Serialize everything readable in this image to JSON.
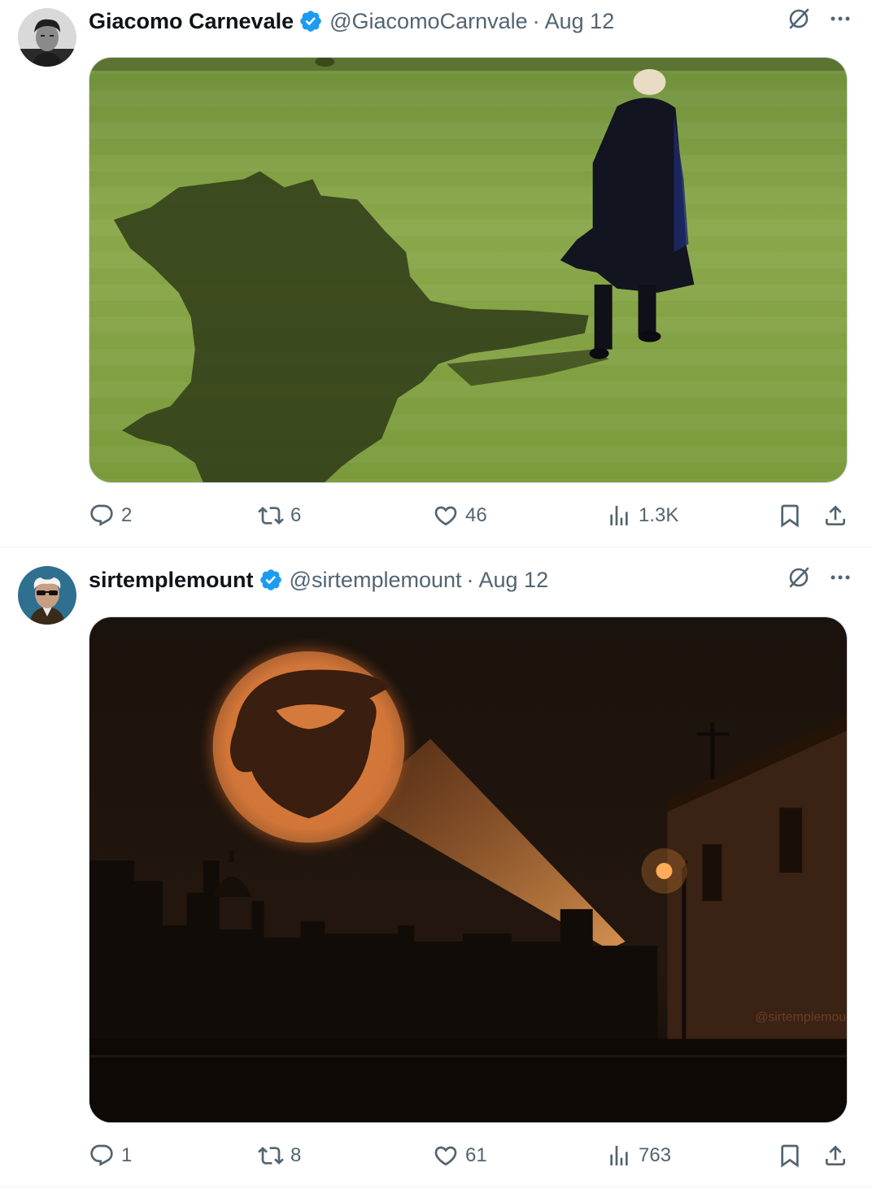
{
  "tweets": [
    {
      "author": {
        "name": "Giacomo Carnevale",
        "handle": "@GiacomoCarnvale",
        "verified": true
      },
      "separator": "·",
      "time": "Aug 12",
      "stats": {
        "replies": "2",
        "retweets": "6",
        "likes": "46",
        "views": "1.3K"
      }
    },
    {
      "author": {
        "name": "sirtemplemount",
        "handle": "@sirtemplemount",
        "verified": true
      },
      "separator": "·",
      "time": "Aug 12",
      "media_watermark": "@sirtemplemount",
      "stats": {
        "replies": "1",
        "retweets": "8",
        "likes": "61",
        "views": "763"
      }
    }
  ],
  "icons": {
    "verified_badge": "verified-badge-icon",
    "grok": "grok-icon",
    "more": "more-icon",
    "reply": "reply-icon",
    "retweet": "retweet-icon",
    "like": "like-icon",
    "views": "views-icon",
    "bookmark": "bookmark-icon",
    "share": "share-icon"
  },
  "colors": {
    "primary_text": "#0f1419",
    "secondary_text": "#536471",
    "verified_blue": "#1d9bf0",
    "divider": "#eff3f4"
  }
}
